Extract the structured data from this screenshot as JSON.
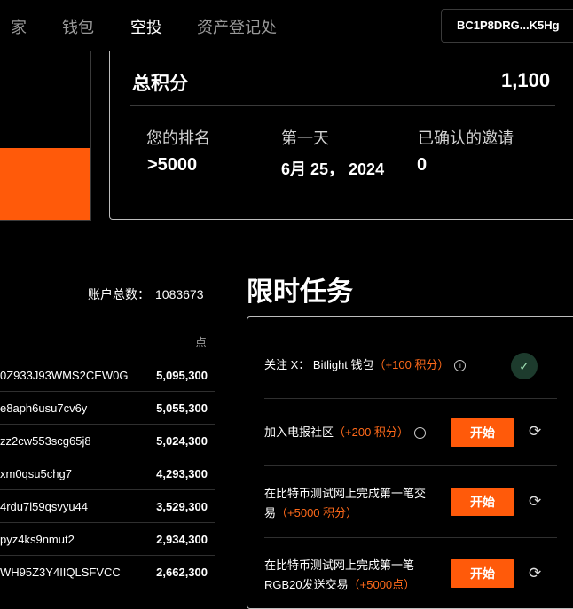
{
  "nav": {
    "items": [
      "家",
      "钱包",
      "空投",
      "资产登记处"
    ],
    "active": "空投",
    "wallet_address": "BC1P8DRG...K5Hg"
  },
  "points_card": {
    "total_label": "总积分",
    "total_value": "1,100",
    "stats": [
      {
        "label": "您的排名",
        "value": ">5000"
      },
      {
        "label": "第一天",
        "value": "6月 25，  2024"
      },
      {
        "label": "已确认的邀请",
        "value": "0"
      }
    ]
  },
  "leaderboard": {
    "account_total_label": "账户总数：",
    "account_total_value": "1083673",
    "points_header": "点",
    "rows": [
      {
        "address": "0Z933J93WMS2CEW0G",
        "points": "5,095,300"
      },
      {
        "address": "e8aph6usu7cv6y",
        "points": "5,055,300"
      },
      {
        "address": "zz2cw553scg65j8",
        "points": "5,024,300"
      },
      {
        "address": "xm0qsu5chg7",
        "points": "4,293,300"
      },
      {
        "address": "4rdu7l59qsvyu44",
        "points": "3,529,300"
      },
      {
        "address": "pyz4ks9nmut2",
        "points": "2,934,300"
      },
      {
        "address": "WH95Z3Y4IIQLSFVCC",
        "points": "2,662,300"
      }
    ]
  },
  "tasks": {
    "title": "限时任务",
    "items": [
      {
        "text": "关注 X：  Bitlight 钱包",
        "points": "（+100 积分）",
        "status": "completed"
      },
      {
        "text": "加入电报社区",
        "points": "（+200 积分）",
        "button": "开始"
      },
      {
        "line1": "在比特币测试网上完成第一笔交",
        "line2": "易",
        "points": "（+5000 积分）",
        "button": "开始"
      },
      {
        "line1": "在比特币测试网上完成第一笔",
        "line2": "RGB20发送交易",
        "points": "（+5000点）",
        "button": "开始"
      }
    ]
  },
  "icons": {
    "info": "info-icon",
    "check": "check-icon",
    "refresh": "refresh-icon"
  },
  "colors": {
    "accent": "#ff5a0a",
    "background": "#000000",
    "check_bg": "#1d3b2d"
  }
}
